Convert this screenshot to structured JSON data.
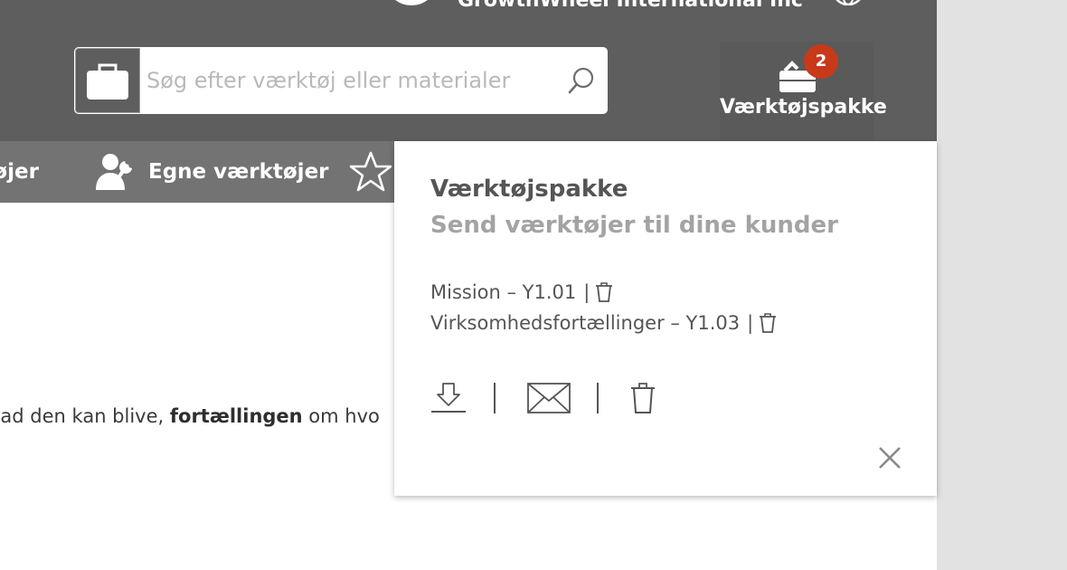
{
  "header": {
    "company_name": "GrowthWheel International Inc",
    "search": {
      "placeholder": "Søg efter værktøj eller materialer"
    },
    "toolkit": {
      "label": "Værktøjspakke",
      "count": "2"
    }
  },
  "nav": {
    "items": [
      {
        "label": "ktøjer"
      },
      {
        "label": "Egne værktøjer"
      }
    ]
  },
  "body": {
    "text_before": "vad den kan blive, ",
    "text_bold": "fortællingen",
    "text_after": " om hvo"
  },
  "toolkit_panel": {
    "title": "Værktøjspakke",
    "subtitle": "Send værktøjer til dine kunder",
    "separator": "|",
    "items": [
      {
        "label": "Mission – Y1.01"
      },
      {
        "label": "Virksomhedsfortællinger – Y1.03"
      }
    ]
  },
  "colors": {
    "header_bg": "#5e5e5e",
    "nav_bg": "#737373",
    "badge": "#c8391a",
    "gutter": "#e2e2e2"
  },
  "icons": [
    "briefcase-icon",
    "search-icon",
    "toolbox-icon",
    "user-wrench-icon",
    "star-icon",
    "trash-icon",
    "download-icon",
    "mail-icon",
    "close-icon",
    "globe-icon"
  ]
}
